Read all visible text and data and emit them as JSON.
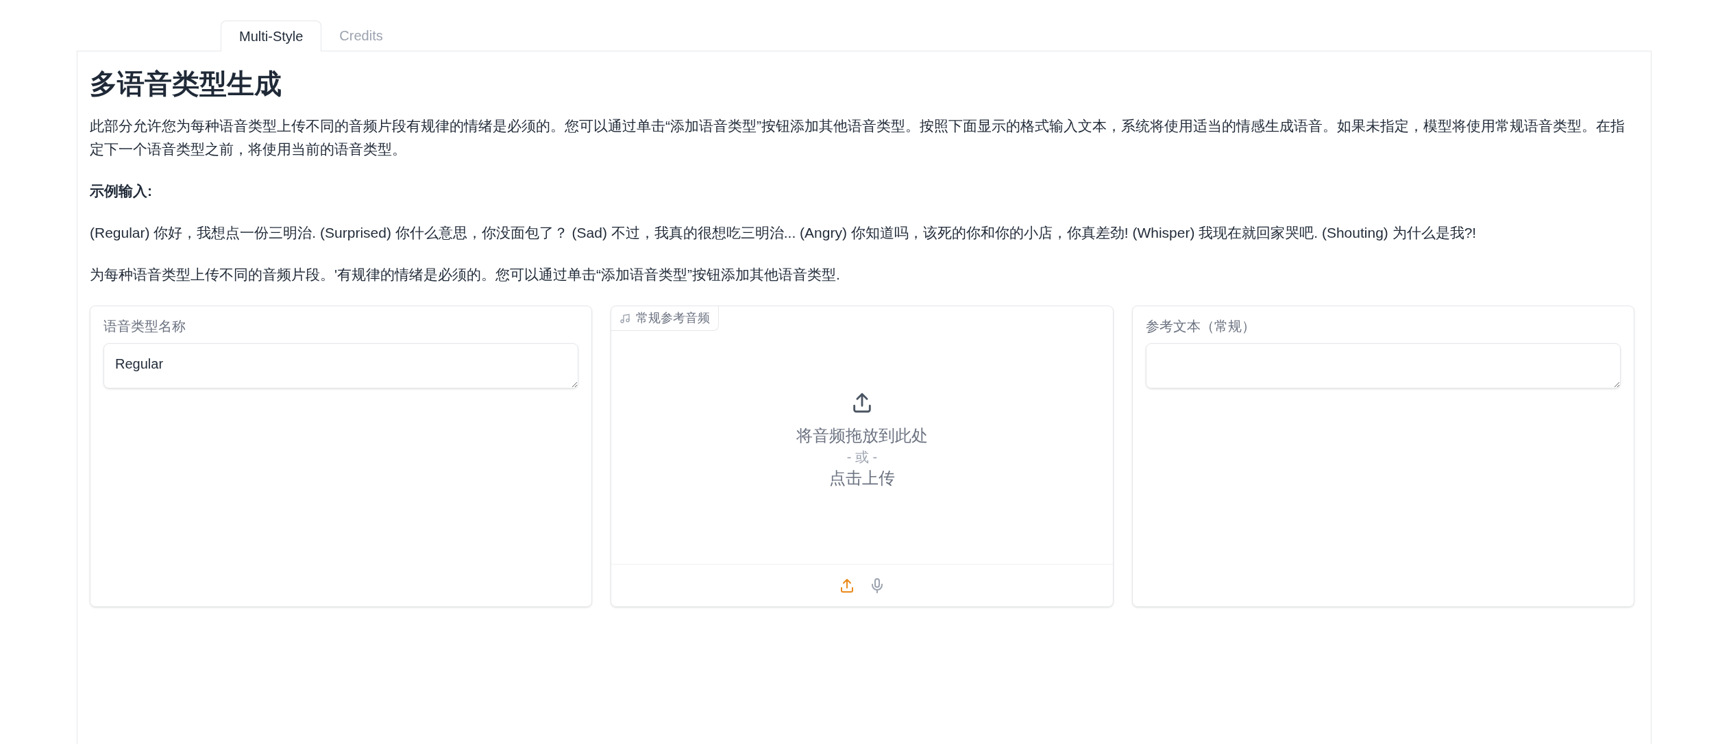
{
  "tabs": [
    {
      "label": "Multi-Style",
      "selected": true
    },
    {
      "label": "Credits",
      "selected": false
    }
  ],
  "heading": "多语音类型生成",
  "paragraphs": [
    {
      "kind": "text",
      "text": "此部分允许您为每种语音类型上传不同的音频片段有规律的情绪是必须的。您可以通过单击“添加语音类型”按钮添加其他语音类型。按照下面显示的格式输入文本，系统将使用适当的情感生成语音。如果未指定，模型将使用常规语音类型。在指定下一个语音类型之前，将使用当前的语音类型。"
    },
    {
      "kind": "label",
      "text": "示例输入:"
    },
    {
      "kind": "text",
      "text": "(Regular) 你好，我想点一份三明治. (Surprised) 你什么意思，你没面包了？ (Sad) 不过，我真的很想吃三明治... (Angry) 你知道吗，该死的你和你的小店，你真差劲! (Whisper) 我现在就回家哭吧. (Shouting) 为什么是我?!"
    },
    {
      "kind": "text",
      "text": "为每种语音类型上传不同的音频片段。'有规律的情绪是必须的。您可以通过单击“添加语音类型”按钮添加其他语音类型."
    }
  ],
  "panels": [
    {
      "kind": "textbox",
      "label": "语音类型名称",
      "value": "Regular"
    },
    {
      "kind": "audio",
      "label": "常规参考音频",
      "drop_text": "将音频拖放到此处",
      "or_text": "- 或 -",
      "click_text": "点击上传"
    },
    {
      "kind": "textbox",
      "label": "参考文本（常规）"
    }
  ]
}
